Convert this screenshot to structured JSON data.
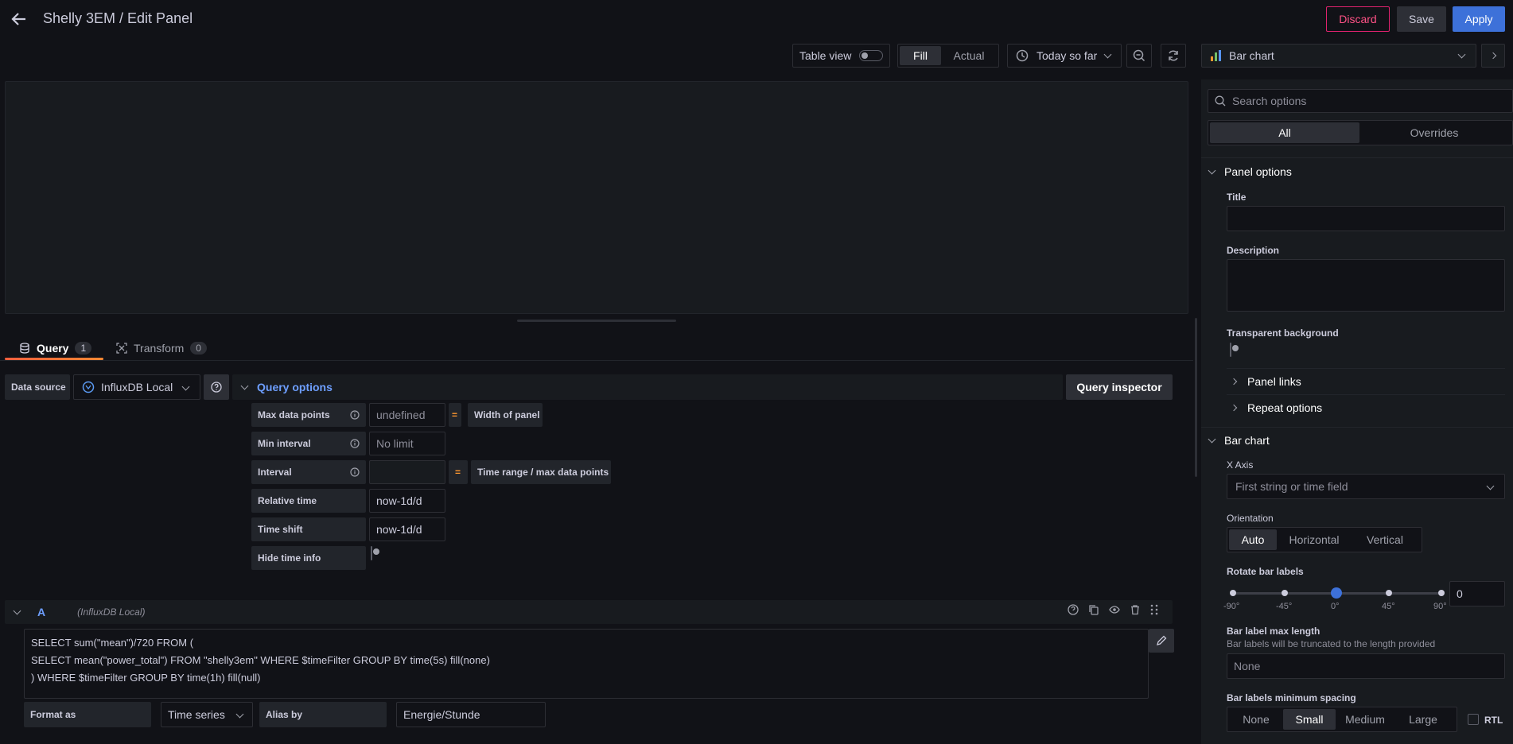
{
  "header": {
    "title": "Shelly 3EM / Edit Panel",
    "discard": "Discard",
    "save": "Save",
    "apply": "Apply"
  },
  "toolbar": {
    "table_view": "Table view",
    "fill": "Fill",
    "actual": "Actual",
    "time_range": "Today so far",
    "viz": "Bar chart"
  },
  "tabs": {
    "query": "Query",
    "query_count": "1",
    "transform": "Transform",
    "transform_count": "0"
  },
  "datasource": {
    "label": "Data source",
    "name": "InfluxDB Local"
  },
  "query_options": {
    "title": "Query options",
    "inspector": "Query inspector",
    "max_data_points": "Max data points",
    "max_data_points_placeholder": "undefined",
    "width_of_panel": "Width of panel",
    "min_interval": "Min interval",
    "min_interval_placeholder": "No limit",
    "interval": "Interval",
    "time_range_max": "Time range / max data points",
    "relative_time": "Relative time",
    "relative_time_value": "now-1d/d",
    "time_shift": "Time shift",
    "time_shift_value": "now-1d/d",
    "hide_time_info": "Hide time info",
    "eq": "="
  },
  "query_a": {
    "ref": "A",
    "ds": "(InfluxDB Local)",
    "line1": "SELECT sum(\"mean\")/720 FROM (",
    "line2": "SELECT mean(\"power_total\") FROM \"shelly3em\" WHERE $timeFilter GROUP BY time(5s) fill(none)",
    "line3": ") WHERE $timeFilter GROUP BY time(1h) fill(null)",
    "format_as": "Format as",
    "format_value": "Time series",
    "alias_by": "Alias by",
    "alias_value": "Energie/Stunde"
  },
  "options": {
    "search_placeholder": "Search options",
    "all": "All",
    "overrides": "Overrides",
    "panel_options": "Panel options",
    "title_label": "Title",
    "description_label": "Description",
    "transparent_bg": "Transparent background",
    "panel_links": "Panel links",
    "repeat_options": "Repeat options",
    "bar_chart": "Bar chart",
    "x_axis": "X Axis",
    "x_axis_value": "First string or time field",
    "orientation": "Orientation",
    "orient_auto": "Auto",
    "orient_horizontal": "Horizontal",
    "orient_vertical": "Vertical",
    "rotate_labels": "Rotate bar labels",
    "rotate_ticks": [
      "-90°",
      "-45°",
      "0°",
      "45°",
      "90°"
    ],
    "rotate_value": "0",
    "max_length": "Bar label max length",
    "max_length_desc": "Bar labels will be truncated to the length provided",
    "max_length_placeholder": "None",
    "min_spacing": "Bar labels minimum spacing",
    "spacing_none": "None",
    "spacing_small": "Small",
    "spacing_medium": "Medium",
    "spacing_large": "Large",
    "rtl": "RTL"
  },
  "colors": {
    "primary": "#3d71d9",
    "danger": "#e0226e",
    "accent_orange": "#f55f3e",
    "link_blue": "#6e9fff"
  }
}
